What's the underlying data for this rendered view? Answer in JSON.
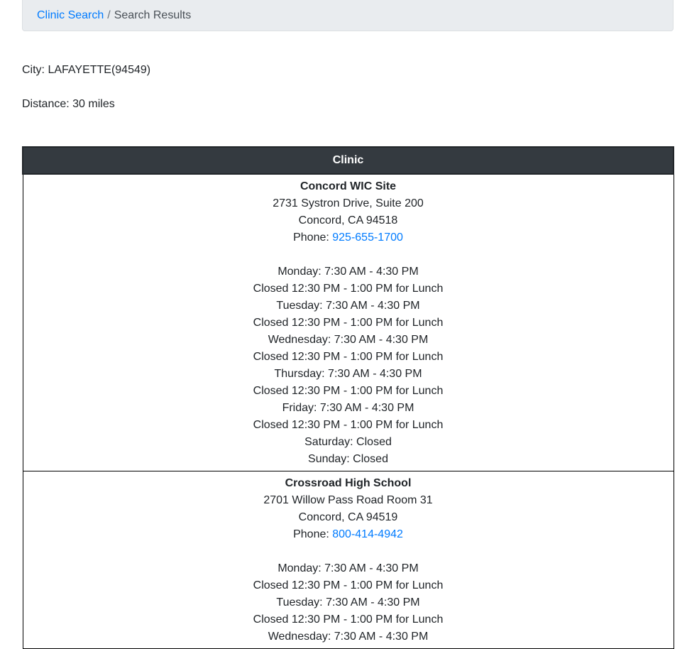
{
  "breadcrumb": {
    "link_label": "Clinic Search",
    "separator": "/",
    "current_label": "Search Results"
  },
  "search_info": {
    "city": "City: LAFAYETTE(94549)",
    "distance": "Distance: 30 miles"
  },
  "table": {
    "header": "Clinic",
    "rows": [
      {
        "name": "Concord WIC Site",
        "address1": "2731 Systron Drive, Suite 200",
        "address2": "Concord, CA 94518",
        "phone_label": "Phone: ",
        "phone": "925-655-1700",
        "hours": [
          "Monday: 7:30 AM - 4:30 PM",
          "Closed 12:30 PM - 1:00 PM for Lunch",
          "Tuesday: 7:30 AM - 4:30 PM",
          "Closed 12:30 PM - 1:00 PM for Lunch",
          "Wednesday: 7:30 AM - 4:30 PM",
          "Closed 12:30 PM - 1:00 PM for Lunch",
          "Thursday: 7:30 AM - 4:30 PM",
          "Closed 12:30 PM - 1:00 PM for Lunch",
          "Friday: 7:30 AM - 4:30 PM",
          "Closed 12:30 PM - 1:00 PM for Lunch",
          "Saturday: Closed",
          "Sunday: Closed"
        ]
      },
      {
        "name": "Crossroad High School",
        "address1": "2701 Willow Pass Road Room 31",
        "address2": "Concord, CA 94519",
        "phone_label": "Phone: ",
        "phone": "800-414-4942",
        "hours": [
          "Monday: 7:30 AM - 4:30 PM",
          "Closed 12:30 PM - 1:00 PM for Lunch",
          "Tuesday: 7:30 AM - 4:30 PM",
          "Closed 12:30 PM - 1:00 PM for Lunch",
          "Wednesday: 7:30 AM - 4:30 PM"
        ]
      }
    ]
  }
}
